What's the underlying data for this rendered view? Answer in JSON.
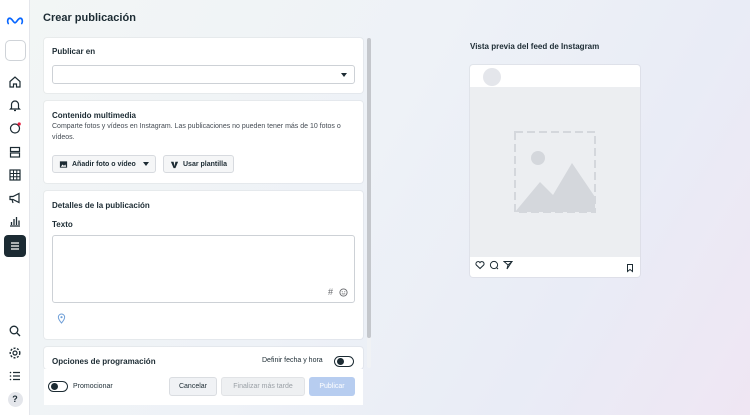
{
  "page": {
    "title": "Crear publicación"
  },
  "rail": {
    "items": [
      "home-icon",
      "bell-icon",
      "post-icon",
      "stack-icon",
      "grid-icon",
      "megaphone-icon",
      "chart-icon",
      "menu-icon"
    ],
    "bottom": [
      "search-icon",
      "gear-icon",
      "list-icon",
      "help-icon"
    ],
    "help_label": "?"
  },
  "publish_in": {
    "title": "Publicar en",
    "value": ""
  },
  "media": {
    "title": "Contenido multimedia",
    "description": "Comparte fotos y vídeos en Instagram. Las publicaciones no pueden tener más de 10 fotos o vídeos.",
    "add_button": "Añadir foto o vídeo",
    "template_button": "Usar plantilla"
  },
  "details": {
    "title": "Detalles de la publicación",
    "text_label": "Texto",
    "text_value": "",
    "hashtag_symbol": "#"
  },
  "scheduling": {
    "title": "Opciones de programación",
    "toggle_label": "Definir fecha y hora",
    "toggle_on": false
  },
  "footer": {
    "promote_label": "Promocionar",
    "promote_on": false,
    "cancel": "Cancelar",
    "finish_later": "Finalizar más tarde",
    "publish": "Publicar"
  },
  "preview": {
    "title": "Vista previa del feed de Instagram"
  },
  "colors": {
    "publish_disabled": "#b7cdf0",
    "accent": "#1c2b33",
    "meta_blue": "#0866ff"
  }
}
